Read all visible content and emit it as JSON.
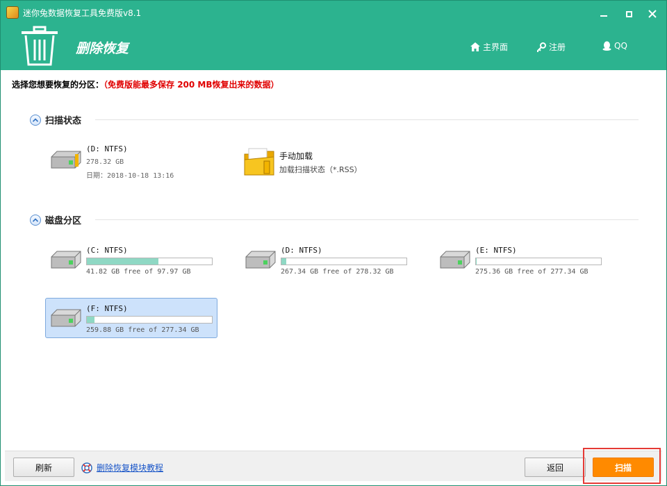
{
  "window": {
    "title": "迷你兔数据恢复工具免费版v8.1",
    "section_title": "删除恢复"
  },
  "nav": [
    {
      "label": "主界面",
      "icon": "home-icon"
    },
    {
      "label": "注册",
      "icon": "key-icon"
    },
    {
      "label": "QQ",
      "icon": "qq-penguin-icon"
    }
  ],
  "prompt": {
    "label": "选择您想要恢复的分区：",
    "note": "（免费版能最多保存 200 MB恢复出来的数据）"
  },
  "scan_status": {
    "heading": "扫描状态",
    "saved_scan": {
      "name": "(D: NTFS)",
      "size": "278.32 GB",
      "date": "日期：2018-10-18 13:16"
    },
    "manual_load": {
      "title": "手动加载",
      "subtitle": "加载扫描状态（*.RSS）"
    }
  },
  "partitions": {
    "heading": "磁盘分区",
    "items": [
      {
        "name": "(C: NTFS)",
        "usage": "41.82 GB free of 97.97 GB",
        "used_fraction": 0.573,
        "selected": false
      },
      {
        "name": "(D: NTFS)",
        "usage": "267.34 GB free of 278.32 GB",
        "used_fraction": 0.039,
        "selected": false
      },
      {
        "name": "(E: NTFS)",
        "usage": "275.36 GB free of 277.34 GB",
        "used_fraction": 0.007,
        "selected": false
      },
      {
        "name": "(F: NTFS)",
        "usage": "259.88 GB free of 277.34 GB",
        "used_fraction": 0.063,
        "selected": true
      }
    ]
  },
  "footer": {
    "refresh_label": "刷新",
    "help_link": "删除恢复模块教程",
    "back_label": "返回",
    "scan_label": "扫描"
  },
  "colors": {
    "header": "#2cb38f",
    "scan_button": "#ff8a00",
    "highlight_frame": "#e53935",
    "bar_fill": "#8fd8c4",
    "note": "#e00000"
  }
}
